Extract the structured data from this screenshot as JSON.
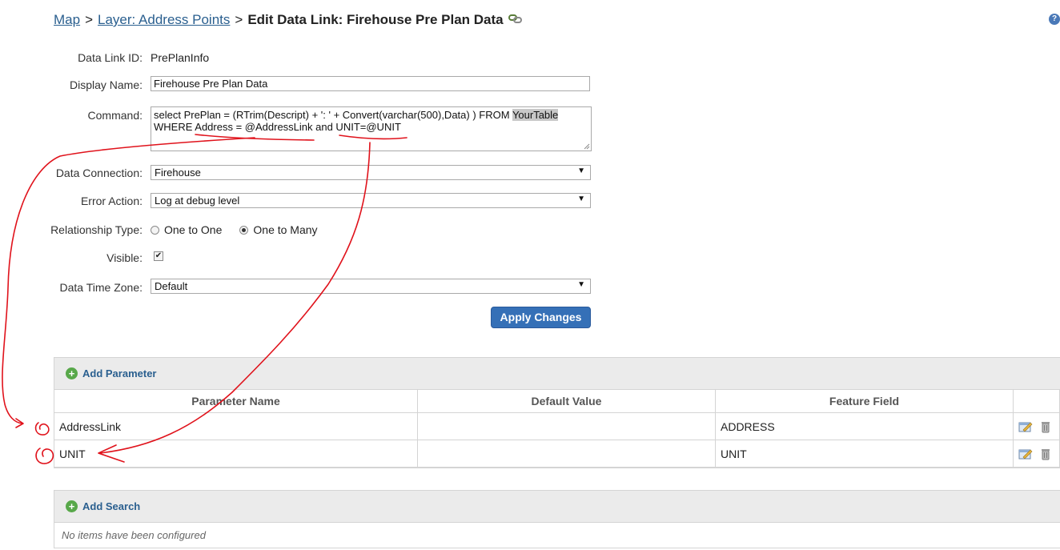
{
  "breadcrumb": {
    "map": "Map",
    "sep1": ">",
    "layer": "Layer: Address Points",
    "sep2": ">",
    "current": "Edit Data Link: Firehouse Pre Plan Data"
  },
  "help_label": "?",
  "form": {
    "data_link_id_label": "Data Link ID:",
    "data_link_id_value": "PrePlanInfo",
    "display_name_label": "Display Name:",
    "display_name_value": "Firehouse Pre Plan Data",
    "command_label": "Command:",
    "command_line1": "select PrePlan = (RTrim(Descript) + ': ' + Convert(varchar(500),Data) ) FROM ",
    "command_line1_highlight": "YourTable",
    "command_line2": "WHERE Address = @AddressLink and UNIT=@UNIT",
    "data_connection_label": "Data Connection:",
    "data_connection_value": "Firehouse",
    "error_action_label": "Error Action:",
    "error_action_value": "Log at debug level",
    "relationship_type_label": "Relationship Type:",
    "relationship_one_to_one": "One to One",
    "relationship_one_to_many": "One to Many",
    "relationship_selected": "One to Many",
    "visible_label": "Visible:",
    "visible_checked": true,
    "time_zone_label": "Data Time Zone:",
    "time_zone_value": "Default",
    "apply_button": "Apply Changes"
  },
  "parameters": {
    "add_label": "Add Parameter",
    "columns": [
      "Parameter Name",
      "Default Value",
      "Feature Field"
    ],
    "rows": [
      {
        "name": "AddressLink",
        "default": "",
        "field": "ADDRESS"
      },
      {
        "name": "UNIT",
        "default": "",
        "field": "UNIT"
      }
    ]
  },
  "searches": {
    "add_label": "Add Search",
    "empty_text": "No items have been configured"
  },
  "colors": {
    "accent": "#3570b7",
    "link": "#2a5f8f",
    "annotation": "#e0121b",
    "add_icon": "#58a84a"
  },
  "icons": [
    "link-icon",
    "help-icon",
    "add-icon",
    "edit-icon",
    "delete-icon",
    "dropdown-caret-icon"
  ]
}
